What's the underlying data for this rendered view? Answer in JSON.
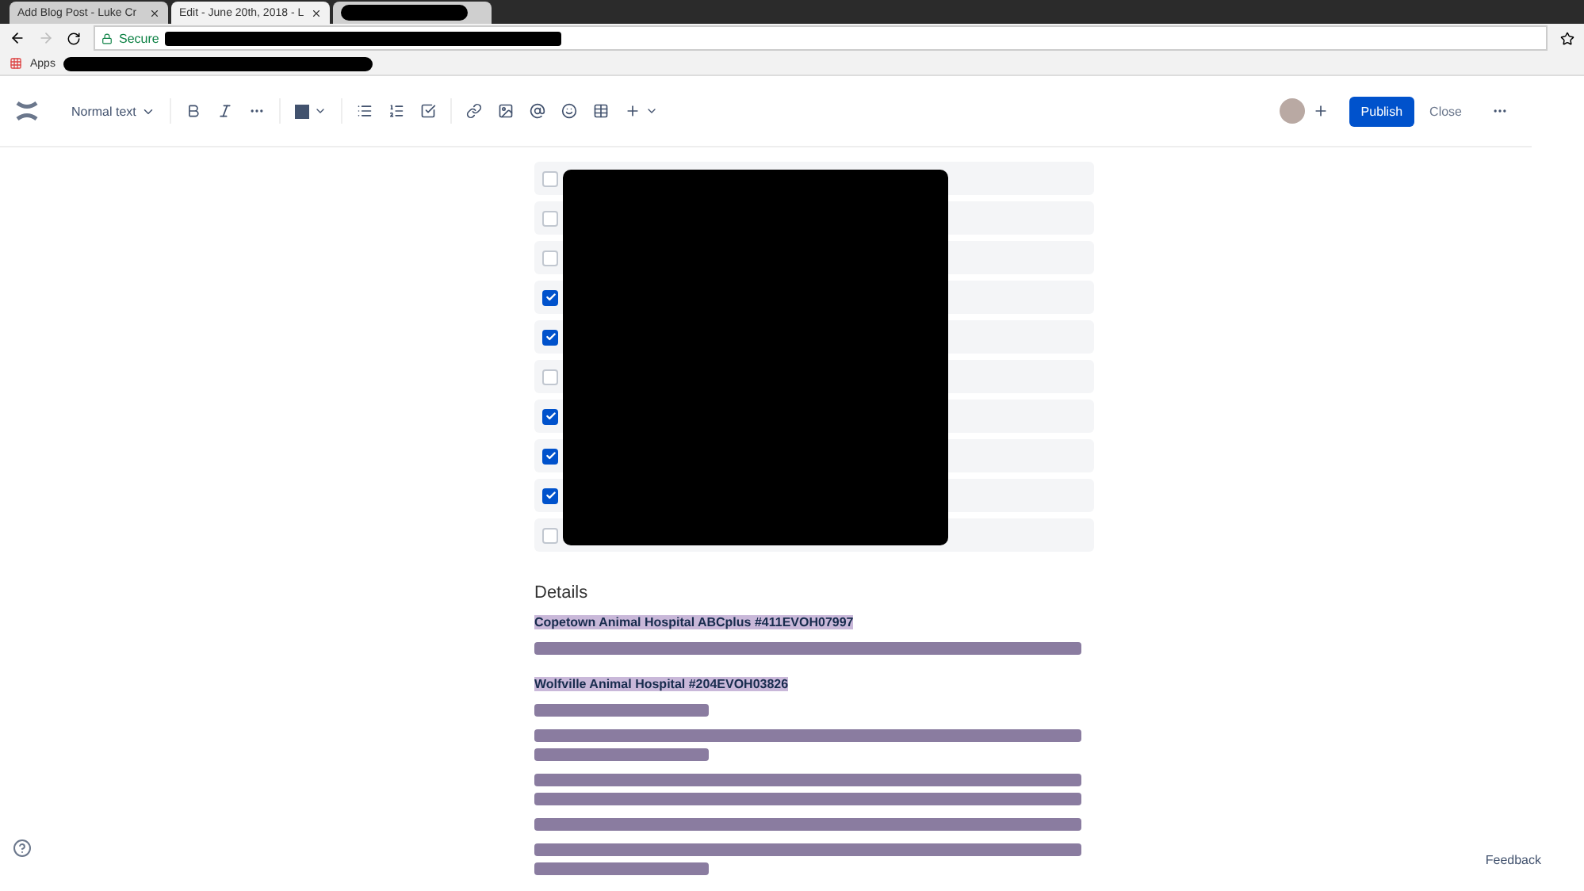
{
  "browser": {
    "tabs": [
      {
        "kind": "page",
        "title": "Add Blog Post - Luke Cr",
        "selected": false
      },
      {
        "kind": "page",
        "title": "Edit - June 20th, 2018 - L",
        "selected": true
      },
      {
        "kind": "redacted",
        "selected": false
      }
    ],
    "secure_label": "Secure",
    "bookmarks": {
      "apps_label": "Apps"
    }
  },
  "toolbar": {
    "text_style": "Normal text",
    "publish": "Publish",
    "close": "Close"
  },
  "tasks": [
    {
      "checked": false
    },
    {
      "checked": false
    },
    {
      "checked": false
    },
    {
      "checked": true
    },
    {
      "checked": true
    },
    {
      "checked": false
    },
    {
      "checked": true
    },
    {
      "checked": true
    },
    {
      "checked": true
    },
    {
      "checked": false
    }
  ],
  "details": {
    "title": "Details",
    "sections": [
      {
        "heading": "Copetown Animal Hospital ABCplus #411EVOH07997",
        "paragraphs": [
          {
            "lines": [
              {
                "kind": "long"
              }
            ]
          }
        ]
      },
      {
        "heading": "Wolfville Animal Hospital #204EVOH03826",
        "paragraphs": [
          {
            "lines": [
              {
                "kind": "short"
              }
            ]
          },
          {
            "lines": [
              {
                "kind": "long"
              },
              {
                "kind": "short"
              }
            ]
          },
          {
            "lines": [
              {
                "kind": "long"
              },
              {
                "kind": "long"
              }
            ]
          },
          {
            "lines": [
              {
                "kind": "long"
              }
            ]
          },
          {
            "lines": [
              {
                "kind": "long"
              },
              {
                "kind": "short"
              }
            ]
          }
        ]
      }
    ]
  },
  "feedback": "Feedback"
}
